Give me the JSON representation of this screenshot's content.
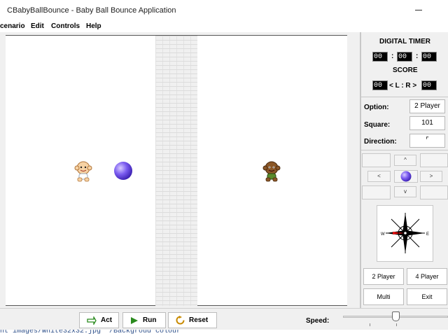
{
  "window": {
    "title": "CBabyBallBounce - Baby Ball Bounce Application"
  },
  "menu": {
    "items": [
      "cenario",
      "Edit",
      "Controls",
      "Help"
    ]
  },
  "panel": {
    "timer_title": "DIGITAL TIMER",
    "timer": {
      "h": "00",
      "m": "00",
      "s": "00",
      "sep": ":"
    },
    "score_title": "SCORE",
    "score": {
      "left": "00",
      "right": "00",
      "sep": "< L : R >"
    },
    "option_label": "Option:",
    "option_value": "2 Player",
    "square_label": "Square:",
    "square_value": "101",
    "direction_label": "Direction:",
    "direction_value": "⌜",
    "pad": {
      "up": "^",
      "down": "v",
      "left": "<",
      "right": ">"
    },
    "compass": {
      "w": "W",
      "e": "E"
    },
    "buttons": {
      "two_player": "2 Player",
      "four_player": "4 Player",
      "multi": "Multi",
      "exit": "Exit"
    }
  },
  "controls": {
    "act": "Act",
    "run": "Run",
    "reset": "Reset",
    "speed_label": "Speed:",
    "speed_value": 0.47
  },
  "status": {
    "text": "nt images/white32x32.jpg \"/Backgroud colour\""
  },
  "colors": {
    "ball": "#7b5cf0",
    "accent_green": "#2a8a1e",
    "reset_orange": "#c88a00"
  }
}
